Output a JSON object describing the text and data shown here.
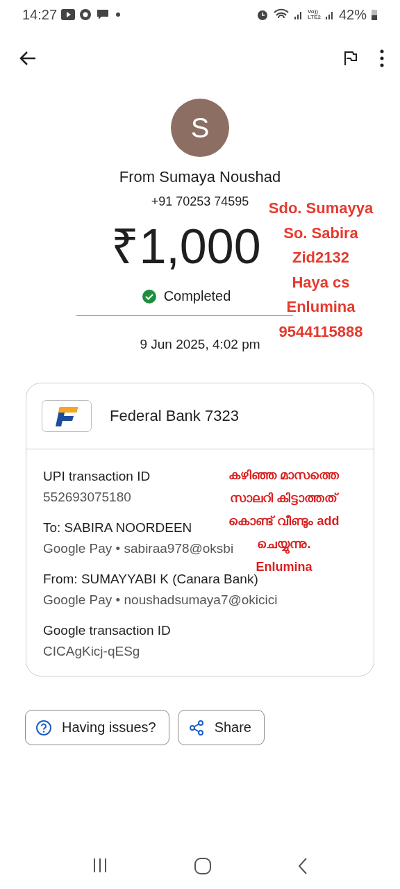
{
  "status_bar": {
    "time": "14:27",
    "network_label": [
      "Vo))",
      "LTE2"
    ],
    "battery": "42%"
  },
  "sender": {
    "initial": "S",
    "name": "From Sumaya Noushad",
    "phone": "+91 70253 74595"
  },
  "amount": "₹1,000",
  "status": {
    "label": "Completed",
    "kind": "completed"
  },
  "date": "9 Jun 2025, 4:02 pm",
  "card": {
    "bank": "Federal Bank 7323",
    "details": [
      {
        "label": "UPI transaction ID",
        "value": "552693075180"
      },
      {
        "label": "To: SABIRA NOORDEEN",
        "value": "Google Pay • sabiraa978@oksbi"
      },
      {
        "label": "From: SUMAYYABI  K (Canara Bank)",
        "value": "Google Pay • noushadsumaya7@okicici"
      },
      {
        "label": "Google transaction ID",
        "value": "CICAgKicj-qESg"
      }
    ]
  },
  "buttons": [
    {
      "label": "Having issues?",
      "kind": "help"
    },
    {
      "label": "Share",
      "kind": "share"
    }
  ],
  "annotations": [
    {
      "kind": "side",
      "color": "#e53a2e",
      "lines": [
        "Sdo. Sumayya",
        "So. Sabira",
        "Zid2132",
        "Haya cs",
        "Enlumina",
        "9544115888"
      ]
    },
    {
      "kind": "card",
      "color": "#d91e1e",
      "lines": [
        "കഴിഞ്ഞ മാസത്തെ",
        "സാലറി കിട്ടാത്തത്",
        "കൊണ്ട് വീണ്ടും add",
        "ചെയ്യുന്നു.",
        "Enlumina"
      ]
    }
  ]
}
